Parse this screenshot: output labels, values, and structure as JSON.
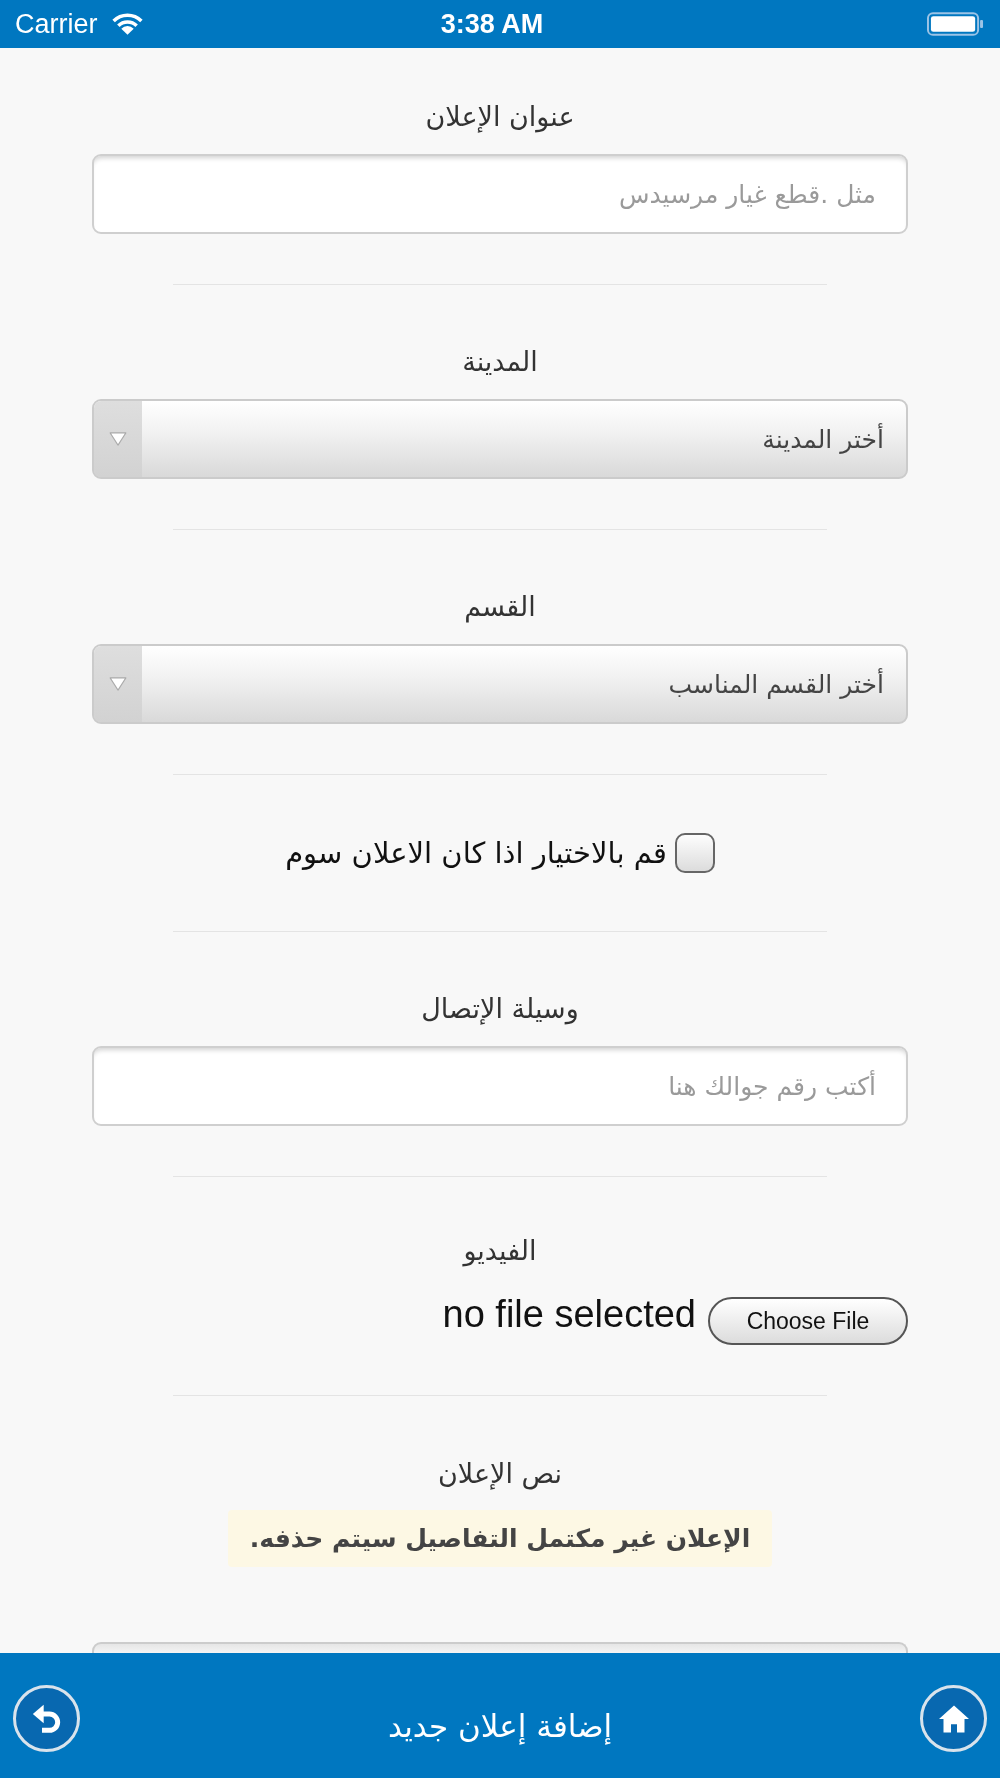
{
  "status_bar": {
    "carrier": "Carrier",
    "time": "3:38 AM"
  },
  "form": {
    "fields": [
      {
        "kind": "text",
        "label": "عنوان الإعلان",
        "placeholder": "مثل .قطع غيار مرسيدس"
      },
      {
        "kind": "select",
        "label": "المدينة",
        "value": "أختر المدينة"
      },
      {
        "kind": "select",
        "label": "القسم",
        "value": "أختر القسم المناسب"
      },
      {
        "kind": "checkbox",
        "label": "قم بالاختيار اذا كان الاعلان سوم",
        "checked": false
      },
      {
        "kind": "text",
        "label": "وسيلة الإتصال",
        "placeholder": "أكتب رقم جوالك هنا"
      },
      {
        "kind": "file",
        "label": "الفيديو",
        "status": "no file selected",
        "button": "Choose File"
      },
      {
        "kind": "textarea",
        "label": "نص الإعلان",
        "notice": "الإعلان غير مكتمل التفاصيل سيتم حذفه."
      }
    ]
  },
  "bottom_bar": {
    "title": "إضافة إعلان جديد"
  }
}
